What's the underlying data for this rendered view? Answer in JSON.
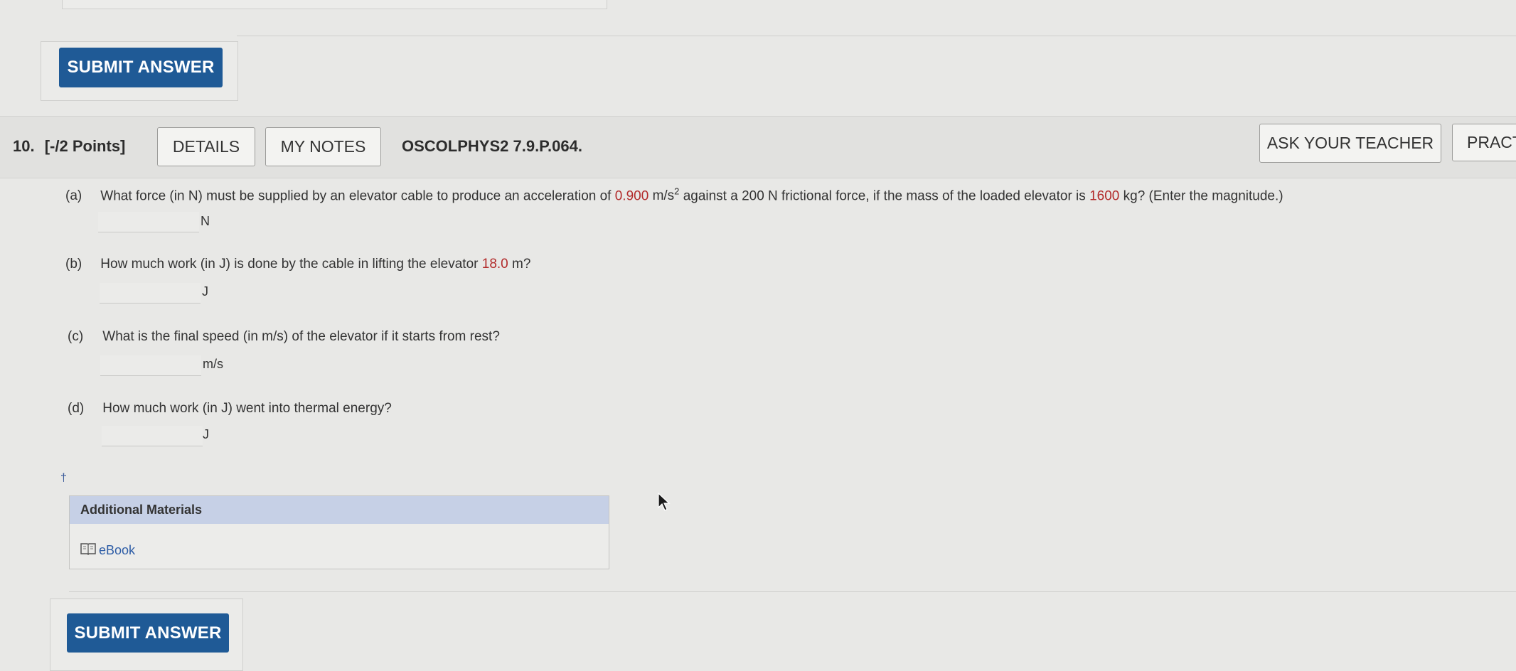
{
  "top_submit": {
    "label": "SUBMIT ANSWER"
  },
  "question": {
    "number": "10.",
    "points": "[-/2 Points]",
    "details_label": "DETAILS",
    "notes_label": "MY NOTES",
    "code": "OSCOLPHYS2 7.9.P.064.",
    "ask_teacher_label": "ASK YOUR TEACHER",
    "practice_label": "PRACT"
  },
  "parts": {
    "a": {
      "letter": "(a)",
      "text_1": "What force (in N) must be supplied by an elevator cable to produce an acceleration of",
      "accel_value": "0.900",
      "accel_unit": "m/s",
      "accel_exp": "2",
      "text_2": "against a 200 N frictional force, if the mass of the loaded elevator is",
      "mass_value": "1600",
      "text_3": "kg? (Enter the magnitude.)",
      "unit": "N"
    },
    "b": {
      "letter": "(b)",
      "text_1": "How much work (in J) is done by the cable in lifting the elevator",
      "height_value": "18.0",
      "text_2": "m?",
      "unit": "J"
    },
    "c": {
      "letter": "(c)",
      "text": "What is the final speed (in m/s) of the elevator if it starts from rest?",
      "unit": "m/s"
    },
    "d": {
      "letter": "(d)",
      "text": "How much work (in J) went into thermal energy?",
      "unit": "J"
    }
  },
  "dagger": "†",
  "additional_materials": {
    "title": "Additional Materials",
    "ebook_label": "eBook",
    "ebook_icon": "book-icon"
  },
  "bottom_submit": {
    "label": "SUBMIT ANSWER"
  },
  "colors": {
    "submit_bg": "#1f5a96",
    "highlight_red": "#b22a2a",
    "additional_header_bg": "#c6d0e6",
    "link_blue": "#2e5da6"
  }
}
